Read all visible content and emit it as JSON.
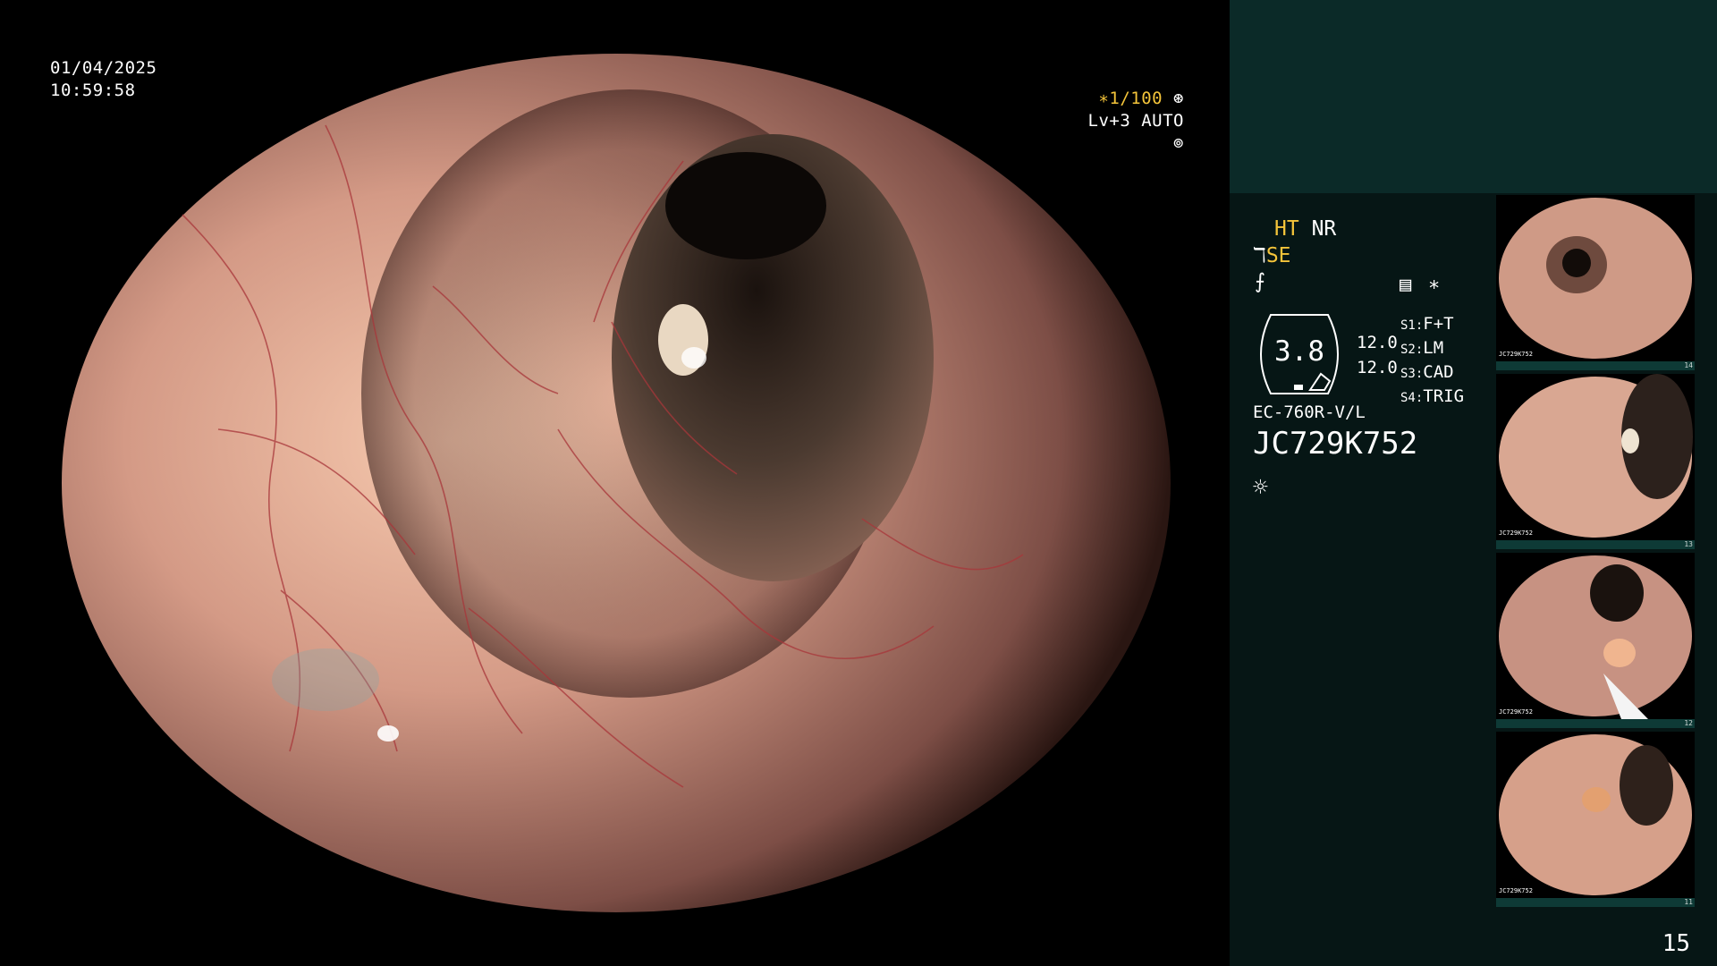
{
  "overlay": {
    "date": "01/04/2025",
    "time": "10:59:58",
    "shutter": "∗1/100",
    "level": "Lv+3",
    "auto": "AUTO"
  },
  "panel": {
    "ht": "HT",
    "nr": "NR",
    "se": "SE",
    "zoom": "3.8",
    "val1": "12.0",
    "val2": "12.0",
    "modes": [
      {
        "key": "S1:",
        "value": "F+T"
      },
      {
        "key": "S2:",
        "value": "LM"
      },
      {
        "key": "S3:",
        "value": "CAD"
      },
      {
        "key": "S4:",
        "value": "TRIG"
      }
    ],
    "scope_model": "EC-760R-V/L",
    "serial": "JC729K752",
    "asterisk": "∗",
    "page_number": "15"
  },
  "thumbnails": [
    {
      "num": "14",
      "serial": "JC729K752"
    },
    {
      "num": "13",
      "serial": "JC729K752"
    },
    {
      "num": "12",
      "serial": "JC729K752"
    },
    {
      "num": "11",
      "serial": "JC729K752"
    }
  ],
  "colors": {
    "mucosa": "#d49a86",
    "lumen": "#2a1d17",
    "panel_bg": "#061615",
    "panel_top": "#0b2a28",
    "accent_yellow": "#f4c43a"
  }
}
